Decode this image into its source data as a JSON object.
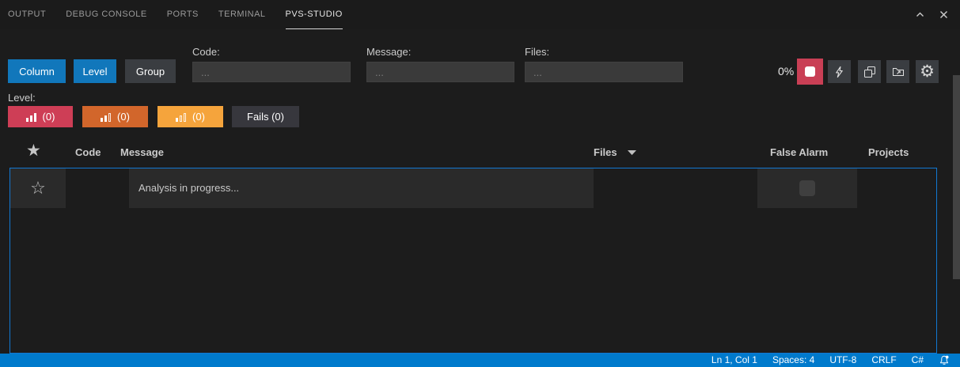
{
  "colors": {
    "accent_blue": "#1177bb",
    "focus_border": "#1278d2",
    "status_bar_blue": "#007acc",
    "stop_red": "#c93f55",
    "level_high_red": "#ce3e56",
    "level_medium_orange": "#d2662b",
    "level_low_orange": "#f5a43c",
    "button_gray": "#3a3d41"
  },
  "tabbar": {
    "tabs": [
      {
        "label": "OUTPUT"
      },
      {
        "label": "DEBUG CONSOLE"
      },
      {
        "label": "PORTS"
      },
      {
        "label": "TERMINAL"
      },
      {
        "label": "PVS-STUDIO"
      }
    ],
    "active_tab": "PVS-STUDIO"
  },
  "toolbar": {
    "column_button": "Column",
    "level_button": "Level",
    "group_button": "Group",
    "filters": {
      "code": {
        "label": "Code:",
        "placeholder": "..."
      },
      "message": {
        "label": "Message:",
        "placeholder": "..."
      },
      "files": {
        "label": "Files:",
        "placeholder": "..."
      }
    },
    "progress_percent": "0%",
    "icons": [
      "stop",
      "lightning",
      "copy",
      "open-folder",
      "settings-gear"
    ]
  },
  "level_filter": {
    "label": "Level:",
    "high_count": "(0)",
    "medium_count": "(0)",
    "low_count": "(0)",
    "fails_label": "Fails (0)"
  },
  "table": {
    "headers": {
      "favorite_icon": "star",
      "code": "Code",
      "message": "Message",
      "files": "Files",
      "false_alarm": "False Alarm",
      "projects": "Projects"
    },
    "rows": [
      {
        "message": "Analysis in progress...",
        "favorite": false,
        "false_alarm": false
      }
    ]
  },
  "status_bar": {
    "cursor_position": "Ln 1, Col 1",
    "indentation": "Spaces: 4",
    "encoding": "UTF-8",
    "eol": "CRLF",
    "language": "C#",
    "bell_icon": "bell-dot"
  }
}
